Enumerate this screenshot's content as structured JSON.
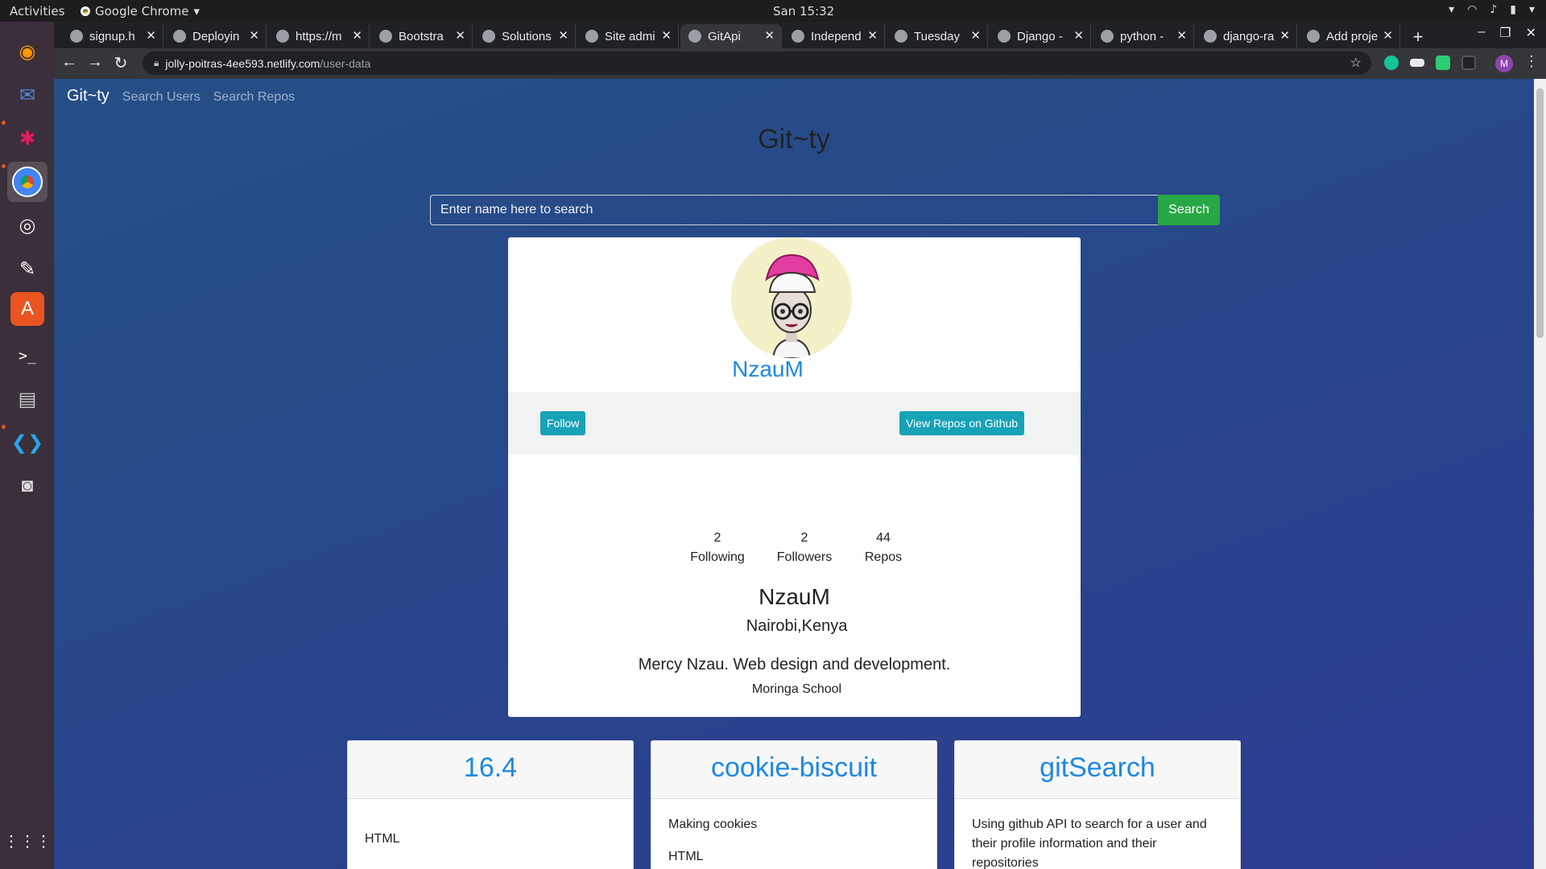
{
  "topbar": {
    "activities": "Activities",
    "app": "Google Chrome",
    "clock": "San 15:32"
  },
  "tabs": [
    {
      "label": "signup.h",
      "active": false
    },
    {
      "label": "Deployin",
      "active": false
    },
    {
      "label": "https://m",
      "active": false
    },
    {
      "label": "Bootstra",
      "active": false
    },
    {
      "label": "Solutions",
      "active": false
    },
    {
      "label": "Site admi",
      "active": false
    },
    {
      "label": "GitApi",
      "active": true
    },
    {
      "label": "Independ",
      "active": false
    },
    {
      "label": "Tuesday",
      "active": false
    },
    {
      "label": "Django -",
      "active": false
    },
    {
      "label": "python -",
      "active": false
    },
    {
      "label": "django-ra",
      "active": false
    },
    {
      "label": "Add proje",
      "active": false
    }
  ],
  "address": {
    "host": "jolly-poitras-4ee593.netlify.com",
    "path": "/user-data",
    "profile_initial": "M"
  },
  "nav": {
    "brand": "Git~ty",
    "links": [
      "Search Users",
      "Search Repos"
    ]
  },
  "hero": {
    "title": "Git~ty"
  },
  "search": {
    "placeholder": "Enter name here to search",
    "button": "Search"
  },
  "profile": {
    "username": "NzauM",
    "follow_label": "Follow",
    "repos_link_label": "View Repos on Github",
    "stats": [
      {
        "value": "2",
        "label": "Following"
      },
      {
        "value": "2",
        "label": "Followers"
      },
      {
        "value": "44",
        "label": "Repos"
      }
    ],
    "name": "NzauM",
    "location": "Nairobi,Kenya",
    "bio": "Mercy Nzau. Web design and development.",
    "company": "Moringa School"
  },
  "repos": [
    {
      "name": "16.4",
      "description": "",
      "language": "HTML"
    },
    {
      "name": "cookie-biscuit",
      "description": "Making cookies",
      "language": "HTML"
    },
    {
      "name": "gitSearch",
      "description": "Using github API to search for a user and their profile information and their repositories",
      "language": ""
    }
  ],
  "colors": {
    "accent_link": "#1e88e5",
    "search_button": "#28a745",
    "info_button": "#17a2b8"
  }
}
